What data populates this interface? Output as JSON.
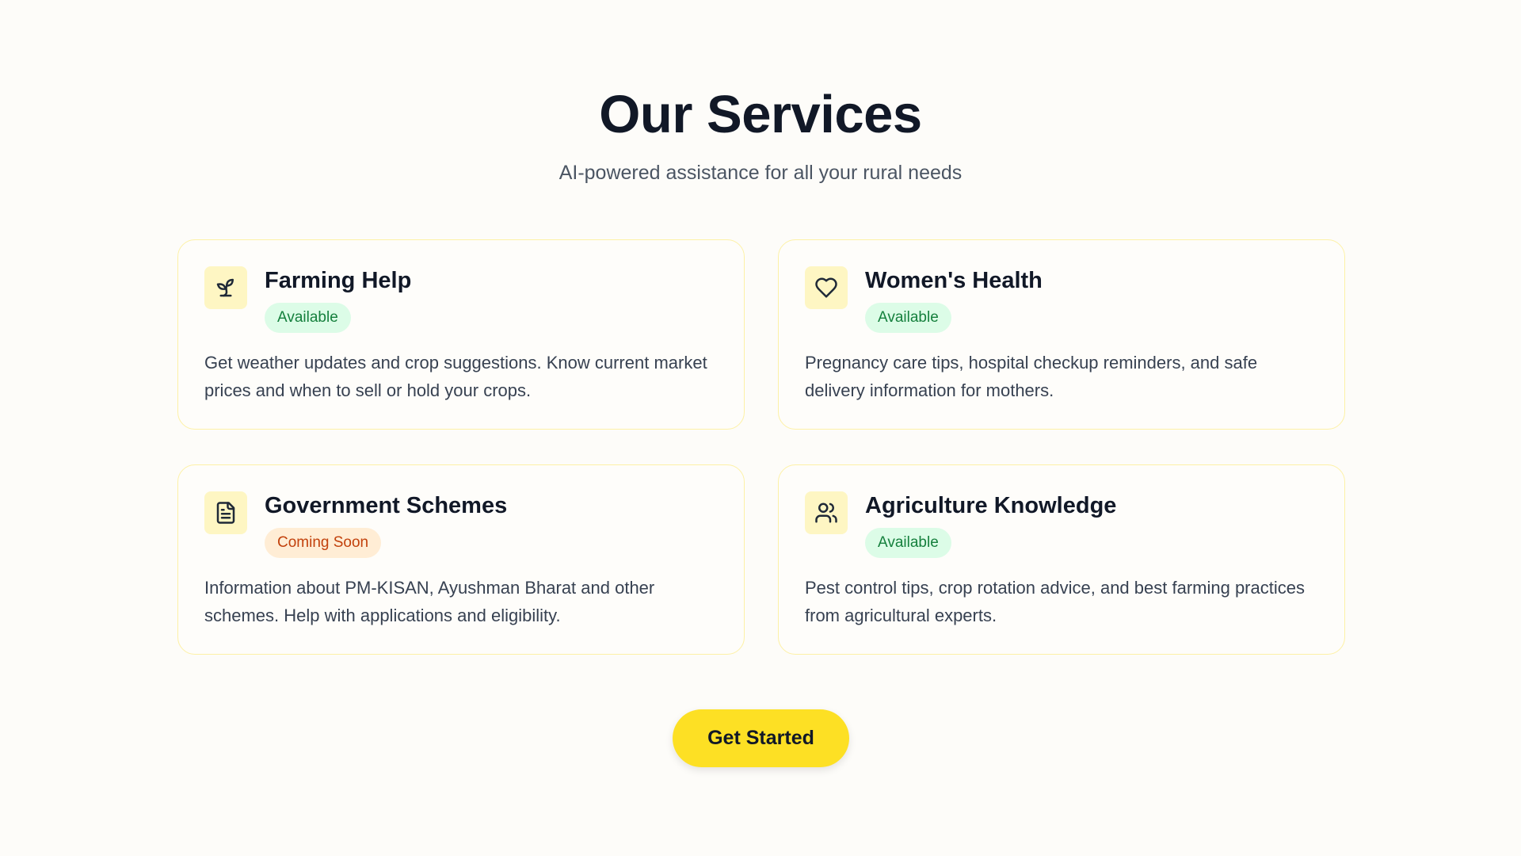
{
  "header": {
    "title": "Our Services",
    "subtitle": "AI-powered assistance for all your rural needs"
  },
  "services": [
    {
      "icon": "sprout-icon",
      "title": "Farming Help",
      "status": "Available",
      "description": "Get weather updates and crop suggestions. Know current market prices and when to sell or hold your crops."
    },
    {
      "icon": "heart-icon",
      "title": "Women's Health",
      "status": "Available",
      "description": "Pregnancy care tips, hospital checkup reminders, and safe delivery information for mothers."
    },
    {
      "icon": "document-icon",
      "title": "Government Schemes",
      "status": "Coming Soon",
      "description": "Information about PM-KISAN, Ayushman Bharat and other schemes. Help with applications and eligibility."
    },
    {
      "icon": "users-icon",
      "title": "Agriculture Knowledge",
      "status": "Available",
      "description": "Pest control tips, crop rotation advice, and best farming practices from agricultural experts."
    }
  ],
  "cta": {
    "label": "Get Started"
  },
  "colors": {
    "accent": "#fde024",
    "available_bg": "#dcfce7",
    "available_text": "#15803d",
    "soon_bg": "#ffedd5",
    "soon_text": "#c2410c",
    "card_border": "#fdf1a6"
  }
}
